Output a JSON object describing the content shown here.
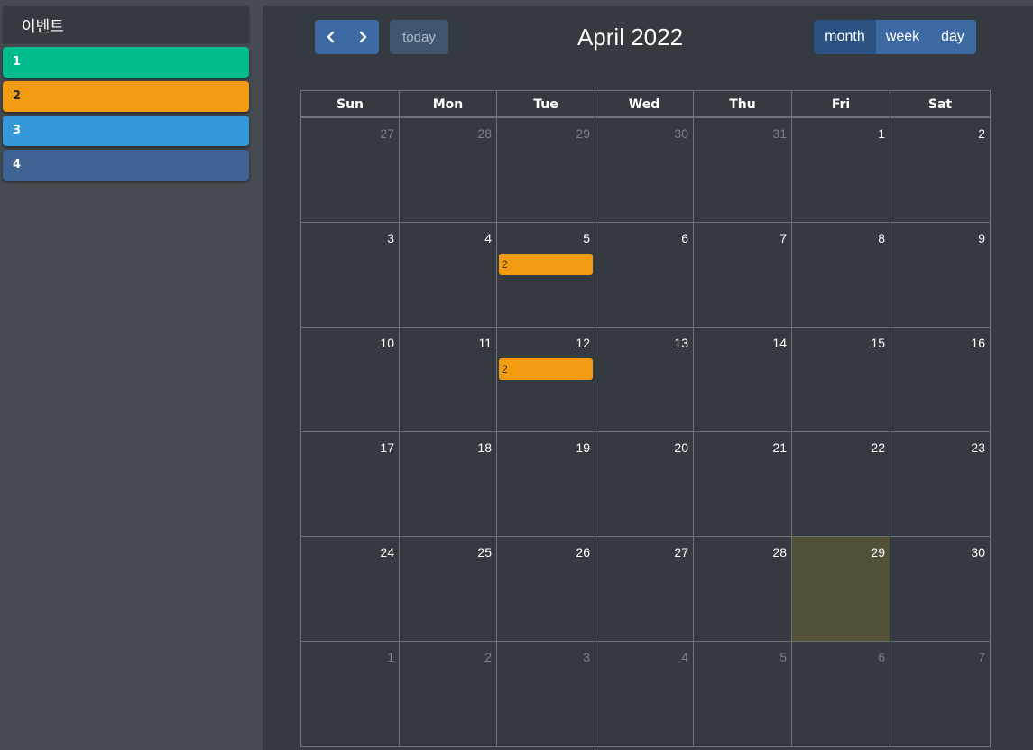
{
  "sidebar": {
    "title": "이벤트",
    "events": [
      {
        "label": "1",
        "color": "#00bc8c",
        "text_color": "#ffffff"
      },
      {
        "label": "2",
        "color": "#f39c12",
        "text_color": "#2b2b2b"
      },
      {
        "label": "3",
        "color": "#3498db",
        "text_color": "#ffffff"
      },
      {
        "label": "4",
        "color": "#3f6493",
        "text_color": "#ffffff"
      }
    ]
  },
  "toolbar": {
    "prev_icon": "chevron-left-icon",
    "next_icon": "chevron-right-icon",
    "today_label": "today",
    "title": "April 2022",
    "views": [
      {
        "label": "month",
        "active": true
      },
      {
        "label": "week",
        "active": false
      },
      {
        "label": "day",
        "active": false
      }
    ]
  },
  "calendar": {
    "weekdays": [
      "Sun",
      "Mon",
      "Tue",
      "Wed",
      "Thu",
      "Fri",
      "Sat"
    ],
    "weeks": [
      [
        {
          "d": "27",
          "other": true
        },
        {
          "d": "28",
          "other": true
        },
        {
          "d": "29",
          "other": true
        },
        {
          "d": "30",
          "other": true
        },
        {
          "d": "31",
          "other": true
        },
        {
          "d": "1"
        },
        {
          "d": "2"
        }
      ],
      [
        {
          "d": "3"
        },
        {
          "d": "4"
        },
        {
          "d": "5",
          "event": "2"
        },
        {
          "d": "6"
        },
        {
          "d": "7"
        },
        {
          "d": "8"
        },
        {
          "d": "9"
        }
      ],
      [
        {
          "d": "10"
        },
        {
          "d": "11"
        },
        {
          "d": "12",
          "event": "2"
        },
        {
          "d": "13"
        },
        {
          "d": "14"
        },
        {
          "d": "15"
        },
        {
          "d": "16"
        }
      ],
      [
        {
          "d": "17"
        },
        {
          "d": "18"
        },
        {
          "d": "19"
        },
        {
          "d": "20"
        },
        {
          "d": "21"
        },
        {
          "d": "22"
        },
        {
          "d": "23"
        }
      ],
      [
        {
          "d": "24"
        },
        {
          "d": "25"
        },
        {
          "d": "26"
        },
        {
          "d": "27"
        },
        {
          "d": "28"
        },
        {
          "d": "29",
          "today": true
        },
        {
          "d": "30"
        }
      ],
      [
        {
          "d": "1",
          "other": true
        },
        {
          "d": "2",
          "other": true
        },
        {
          "d": "3",
          "other": true
        },
        {
          "d": "4",
          "other": true
        },
        {
          "d": "5",
          "other": true
        },
        {
          "d": "6",
          "other": true
        },
        {
          "d": "7",
          "other": true
        }
      ]
    ],
    "today_color": "#525138",
    "event_color": "#f39c12"
  }
}
